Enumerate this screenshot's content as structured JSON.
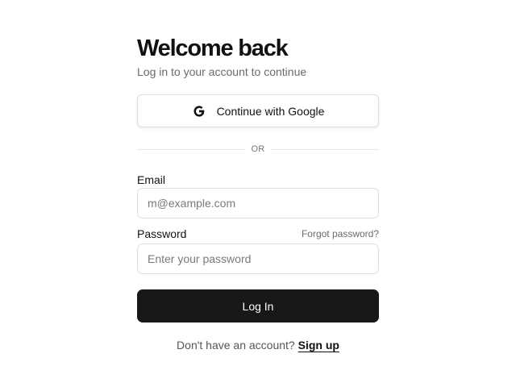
{
  "header": {
    "title": "Welcome back",
    "subtitle": "Log in to your account to continue"
  },
  "google_button": {
    "label": "Continue with Google",
    "icon": "google-icon"
  },
  "divider": {
    "text": "OR"
  },
  "email": {
    "label": "Email",
    "placeholder": "m@example.com",
    "value": ""
  },
  "password": {
    "label": "Password",
    "placeholder": "Enter your password",
    "value": "",
    "forgot_label": "Forgot password?"
  },
  "login_button": {
    "label": "Log In"
  },
  "signup": {
    "prompt": "Don't have an account?",
    "link_label": "Sign up"
  },
  "colors": {
    "primary_button": "#171717",
    "border": "#dedede",
    "muted_text": "#6b6b6b"
  }
}
